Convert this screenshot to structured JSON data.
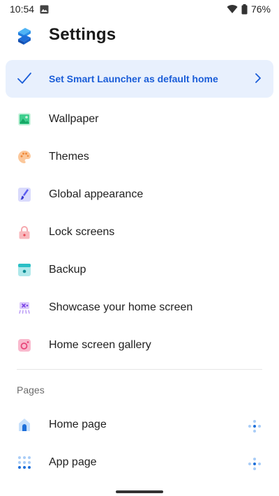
{
  "status_bar": {
    "time": "10:54",
    "battery": "76%"
  },
  "header": {
    "title": "Settings"
  },
  "banner": {
    "label": "Set Smart Launcher as default home"
  },
  "menu": {
    "items": [
      {
        "label": "Wallpaper",
        "icon": "wallpaper-icon",
        "color": "#3fcf8e"
      },
      {
        "label": "Themes",
        "icon": "palette-icon",
        "color": "#f5a25d"
      },
      {
        "label": "Global appearance",
        "icon": "brush-icon",
        "color": "#5b5bf0"
      },
      {
        "label": "Lock screens",
        "icon": "lock-icon",
        "color": "#f06a74"
      },
      {
        "label": "Backup",
        "icon": "backup-icon",
        "color": "#2bbfc6"
      },
      {
        "label": "Showcase your home screen",
        "icon": "showcase-icon",
        "color": "#9b6cf0"
      },
      {
        "label": "Home screen gallery",
        "icon": "gallery-icon",
        "color": "#e8457a"
      }
    ]
  },
  "pages": {
    "section_title": "Pages",
    "items": [
      {
        "label": "Home page",
        "icon": "home-icon"
      },
      {
        "label": "App page",
        "icon": "app-grid-icon"
      }
    ]
  },
  "colors": {
    "accent": "#1a5dd8",
    "banner_bg": "#e8f0fd"
  }
}
